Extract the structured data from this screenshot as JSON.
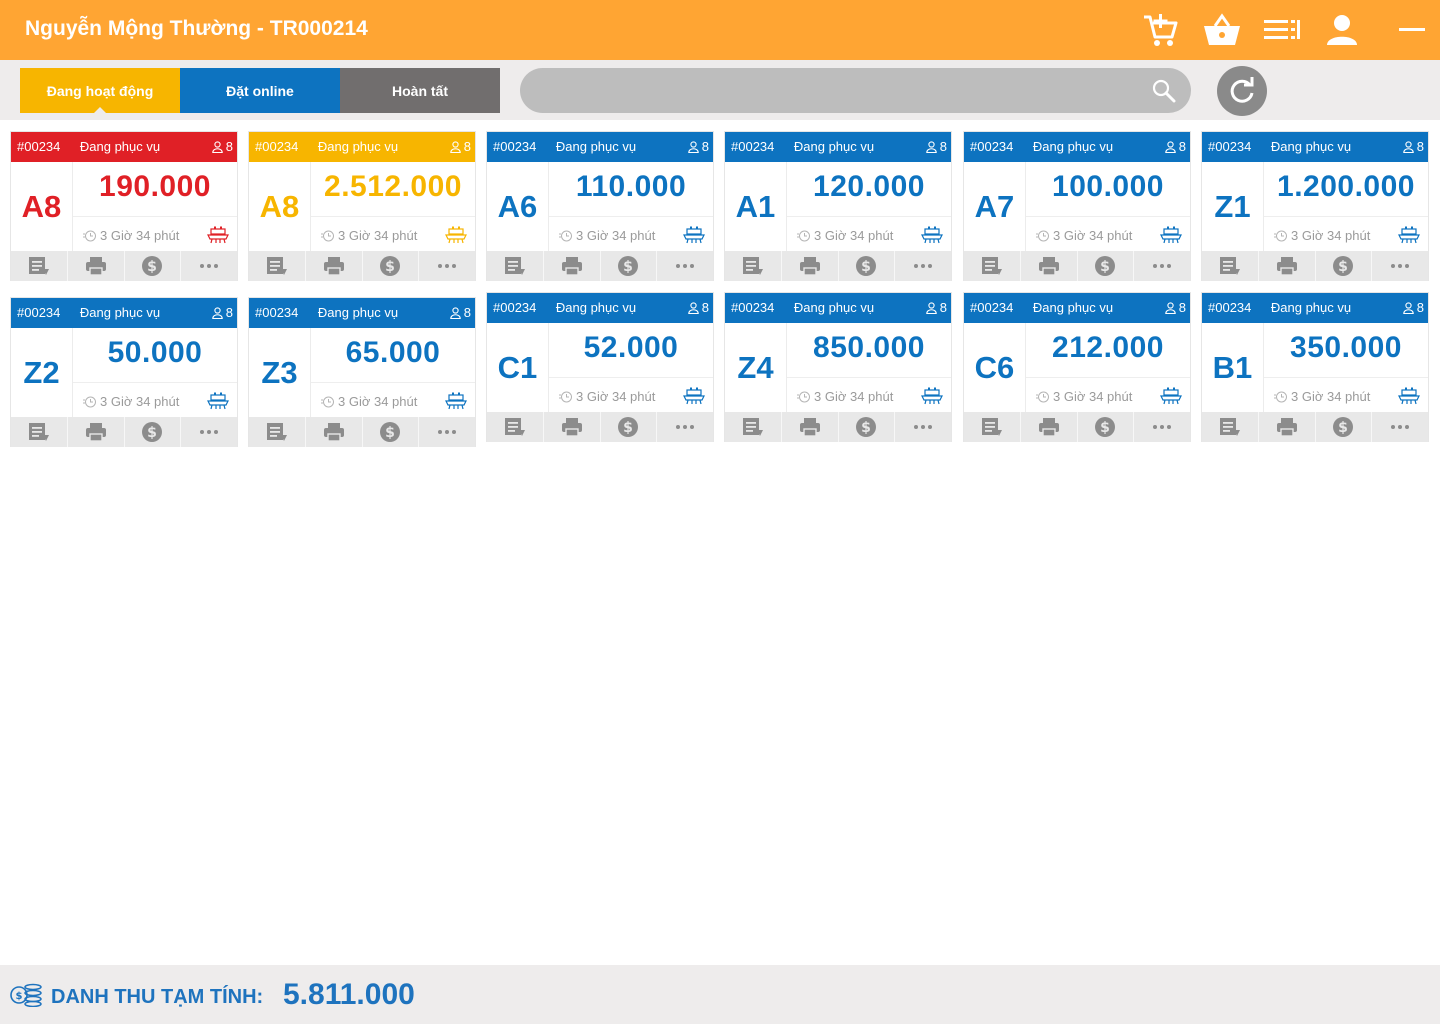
{
  "header": {
    "title": "Nguyễn Mộng Thường - TR000214",
    "icons": [
      "add-to-cart-icon",
      "basket-icon",
      "list-menu-icon",
      "user-icon",
      "minimize-icon"
    ]
  },
  "tabs": [
    {
      "label": "Đang hoạt động",
      "color": "#f7b500",
      "active": true
    },
    {
      "label": "Đặt online",
      "color": "#0d73c0",
      "active": false
    },
    {
      "label": "Hoàn tất",
      "color": "#716e6e",
      "active": false
    }
  ],
  "search": {
    "placeholder": ""
  },
  "colors": {
    "blue": "#0d73c0",
    "red": "#e02026",
    "yellow": "#f7b500",
    "header": "#ffa533"
  },
  "tables": [
    {
      "order": "#00234",
      "status": "Đang phục vụ",
      "guests": "8",
      "name": "A8",
      "amount": "190.000",
      "time": "3 Giờ 34 phút",
      "color": "#e02026"
    },
    {
      "order": "#00234",
      "status": "Đang phục vụ",
      "guests": "8",
      "name": "A8",
      "amount": "2.512.000",
      "time": "3 Giờ 34 phút",
      "color": "#f7b500"
    },
    {
      "order": "#00234",
      "status": "Đang phục vụ",
      "guests": "8",
      "name": "A6",
      "amount": "110.000",
      "time": "3 Giờ 34 phút",
      "color": "#0d73c0"
    },
    {
      "order": "#00234",
      "status": "Đang phục vụ",
      "guests": "8",
      "name": "A1",
      "amount": "120.000",
      "time": "3 Giờ 34 phút",
      "color": "#0d73c0"
    },
    {
      "order": "#00234",
      "status": "Đang phục vụ",
      "guests": "8",
      "name": "A7",
      "amount": "100.000",
      "time": "3 Giờ 34 phút",
      "color": "#0d73c0"
    },
    {
      "order": "#00234",
      "status": "Đang phục vụ",
      "guests": "8",
      "name": "Z1",
      "amount": "1.200.000",
      "time": "3 Giờ 34 phút",
      "color": "#0d73c0"
    },
    {
      "order": "#00234",
      "status": "Đang phục vụ",
      "guests": "8",
      "name": "Z2",
      "amount": "50.000",
      "time": "3 Giờ 34 phút",
      "color": "#0d73c0"
    },
    {
      "order": "#00234",
      "status": "Đang phục vụ",
      "guests": "8",
      "name": "Z3",
      "amount": "65.000",
      "time": "3 Giờ 34 phút",
      "color": "#0d73c0"
    },
    {
      "order": "#00234",
      "status": "Đang phục vụ",
      "guests": "8",
      "name": "C1",
      "amount": "52.000",
      "time": "3 Giờ 34 phút",
      "color": "#0d73c0"
    },
    {
      "order": "#00234",
      "status": "Đang phục vụ",
      "guests": "8",
      "name": "Z4",
      "amount": "850.000",
      "time": "3 Giờ 34 phút",
      "color": "#0d73c0"
    },
    {
      "order": "#00234",
      "status": "Đang phục vụ",
      "guests": "8",
      "name": "C6",
      "amount": "212.000",
      "time": "3 Giờ 34 phút",
      "color": "#0d73c0"
    },
    {
      "order": "#00234",
      "status": "Đang phục vụ",
      "guests": "8",
      "name": "B1",
      "amount": "350.000",
      "time": "3 Giờ 34 phút",
      "color": "#0d73c0"
    }
  ],
  "card_actions": [
    "bill-icon",
    "print-icon",
    "payment-icon",
    "more-icon"
  ],
  "footer": {
    "label": "DANH THU TẠM TÍNH:",
    "total": "5.811.000"
  }
}
